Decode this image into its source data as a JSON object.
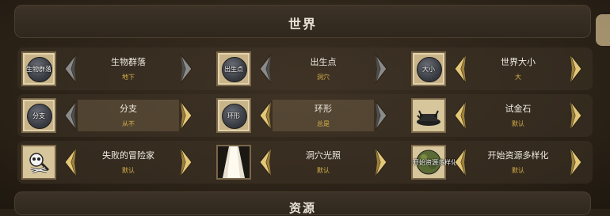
{
  "header": {
    "title": "世界"
  },
  "footer": {
    "title": "资源"
  },
  "colors": {
    "arrow_gold": "#e2c777",
    "arrow_gray": "#8a8a8a",
    "value_text": "#d9b24a"
  },
  "settings": [
    {
      "icon_label": "生物群落",
      "icon": "world-globe-icon",
      "name": "生物群落",
      "value": "地下",
      "left_arrow": "gray",
      "right_arrow": "gray"
    },
    {
      "icon_label": "出生点",
      "icon": "world-globe-icon",
      "name": "出生点",
      "value": "洞穴",
      "left_arrow": "gray",
      "right_arrow": "gray"
    },
    {
      "icon_label": "大小",
      "icon": "world-globe-icon",
      "name": "世界大小",
      "value": "大",
      "left_arrow": "gold",
      "right_arrow": "gold"
    },
    {
      "icon_label": "分支",
      "icon": "world-globe-icon",
      "name": "分支",
      "value": "从不",
      "left_arrow": "gray",
      "right_arrow": "gold"
    },
    {
      "icon_label": "环形",
      "icon": "world-globe-icon",
      "name": "环形",
      "value": "总是",
      "left_arrow": "gold",
      "right_arrow": "gray"
    },
    {
      "icon_label": "",
      "icon": "touchstone-icon",
      "name": "试金石",
      "value": "默认",
      "left_arrow": "gold",
      "right_arrow": "gold"
    },
    {
      "icon_label": "",
      "icon": "skeleton-icon",
      "name": "失败的冒险家",
      "value": "默认",
      "left_arrow": "gold",
      "right_arrow": "gold"
    },
    {
      "icon_label": "",
      "icon": "light-beam-icon",
      "name": "洞穴光照",
      "value": "默认",
      "left_arrow": "gold",
      "right_arrow": "gold"
    },
    {
      "icon_label": "开始资源多样化",
      "icon": "green-map-icon",
      "name": "开始资源多样化",
      "value": "默认",
      "left_arrow": "gold",
      "right_arrow": "gold"
    }
  ]
}
